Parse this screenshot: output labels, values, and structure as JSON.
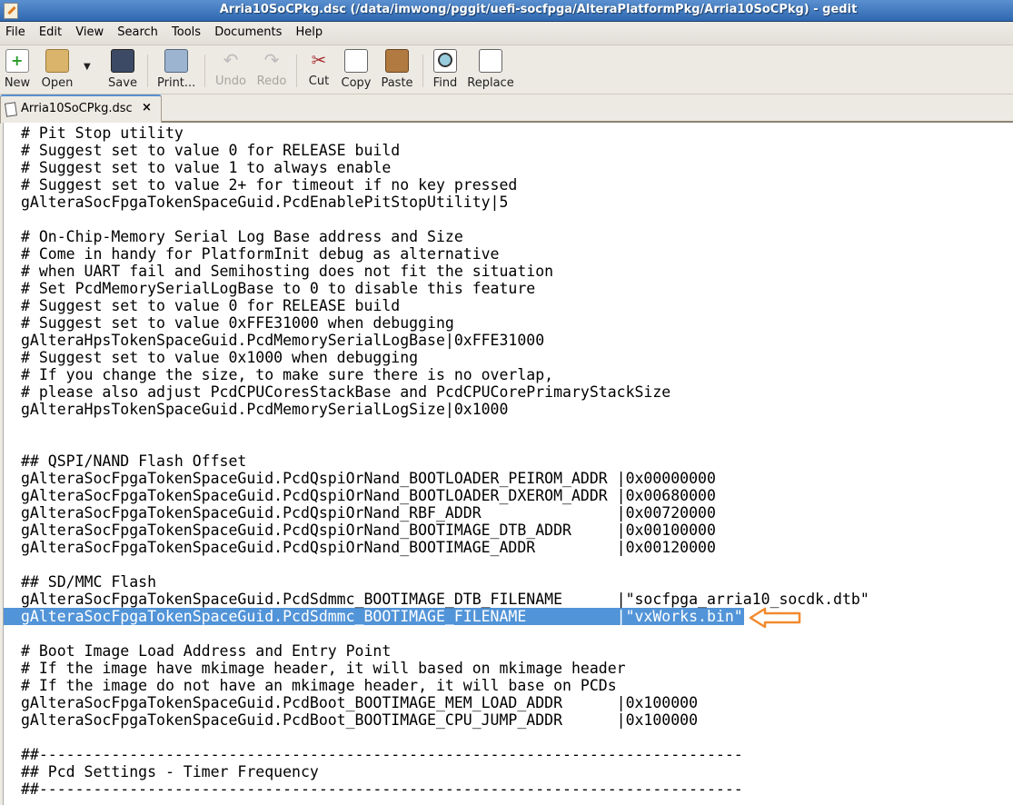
{
  "window": {
    "title": "Arria10SoCPkg.dsc (/data/imwong/pggit/uefi-socfpga/AlteraPlatformPkg/Arria10SoCPkg) - gedit"
  },
  "menu": [
    "File",
    "Edit",
    "View",
    "Search",
    "Tools",
    "Documents",
    "Help"
  ],
  "toolbar": {
    "new": "New",
    "open": "Open",
    "save": "Save",
    "print": "Print...",
    "undo": "Undo",
    "redo": "Redo",
    "cut": "Cut",
    "copy": "Copy",
    "paste": "Paste",
    "find": "Find",
    "replace": "Replace"
  },
  "tab": {
    "label": "Arria10SoCPkg.dsc",
    "close": "×"
  },
  "colors": {
    "selection": "#5294d8",
    "arrow": "#f28a2e",
    "titlebar": "#3a74bf"
  },
  "editor": {
    "selected_line": 28,
    "lines": [
      "# Pit Stop utility",
      "# Suggest set to value 0 for RELEASE build",
      "# Suggest set to value 1 to always enable",
      "# Suggest set to value 2+ for timeout if no key pressed",
      "gAlteraSocFpgaTokenSpaceGuid.PcdEnablePitStopUtility|5",
      "",
      "# On-Chip-Memory Serial Log Base address and Size",
      "# Come in handy for PlatformInit debug as alternative",
      "# when UART fail and Semihosting does not fit the situation",
      "# Set PcdMemorySerialLogBase to 0 to disable this feature",
      "# Suggest set to value 0 for RELEASE build",
      "# Suggest set to value 0xFFE31000 when debugging",
      "gAlteraHpsTokenSpaceGuid.PcdMemorySerialLogBase|0xFFE31000",
      "# Suggest set to value 0x1000 when debugging",
      "# If you change the size, to make sure there is no overlap,",
      "# please also adjust PcdCPUCoresStackBase and PcdCPUCorePrimaryStackSize",
      "gAlteraHpsTokenSpaceGuid.PcdMemorySerialLogSize|0x1000",
      "",
      "",
      "## QSPI/NAND Flash Offset",
      "gAlteraSocFpgaTokenSpaceGuid.PcdQspiOrNand_BOOTLOADER_PEIROM_ADDR |0x00000000",
      "gAlteraSocFpgaTokenSpaceGuid.PcdQspiOrNand_BOOTLOADER_DXEROM_ADDR |0x00680000",
      "gAlteraSocFpgaTokenSpaceGuid.PcdQspiOrNand_RBF_ADDR               |0x00720000",
      "gAlteraSocFpgaTokenSpaceGuid.PcdQspiOrNand_BOOTIMAGE_DTB_ADDR     |0x00100000",
      "gAlteraSocFpgaTokenSpaceGuid.PcdQspiOrNand_BOOTIMAGE_ADDR         |0x00120000",
      "",
      "## SD/MMC Flash",
      "gAlteraSocFpgaTokenSpaceGuid.PcdSdmmc_BOOTIMAGE_DTB_FILENAME      |\"socfpga_arria10_socdk.dtb\"",
      "gAlteraSocFpgaTokenSpaceGuid.PcdSdmmc_BOOTIMAGE_FILENAME          |\"vxWorks.bin\"",
      "",
      "# Boot Image Load Address and Entry Point",
      "# If the image have mkimage header, it will based on mkimage header",
      "# If the image do not have an mkimage header, it will base on PCDs",
      "gAlteraSocFpgaTokenSpaceGuid.PcdBoot_BOOTIMAGE_MEM_LOAD_ADDR      |0x100000",
      "gAlteraSocFpgaTokenSpaceGuid.PcdBoot_BOOTIMAGE_CPU_JUMP_ADDR      |0x100000",
      "",
      "##------------------------------------------------------------------------------",
      "## Pcd Settings - Timer Frequency",
      "##------------------------------------------------------------------------------"
    ]
  }
}
